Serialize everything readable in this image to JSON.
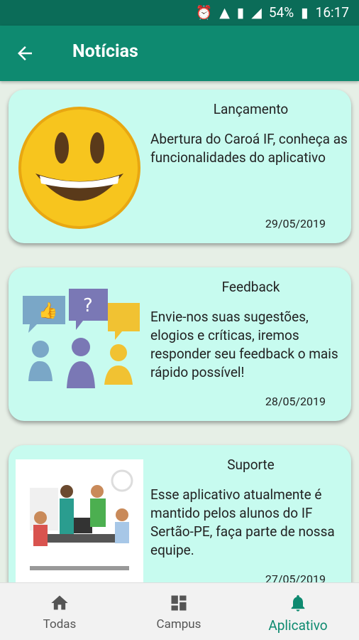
{
  "status_bar": {
    "battery": "54%",
    "time": "16:17"
  },
  "header": {
    "title": "Notícias"
  },
  "news": [
    {
      "category": "Lançamento",
      "text": "Abertura do Caroá IF, conheça as funcionalidades do aplicativo",
      "date": "29/05/2019"
    },
    {
      "category": "Feedback",
      "text": "Envie-nos suas sugestões, elogios e críticas, iremos responder seu feedback o mais rápido possível!",
      "date": "28/05/2019"
    },
    {
      "category": "Suporte",
      "text": "Esse aplicativo atualmente é mantido pelos alunos do IF Sertão-PE, faça parte de nossa equipe.",
      "date": "27/05/2019"
    }
  ],
  "bottom_nav": {
    "todas": "Todas",
    "campus": "Campus",
    "aplicativo": "Aplicativo"
  },
  "colors": {
    "primary": "#0e8a70",
    "status": "#0b6c58",
    "card": "#c7fbef"
  }
}
